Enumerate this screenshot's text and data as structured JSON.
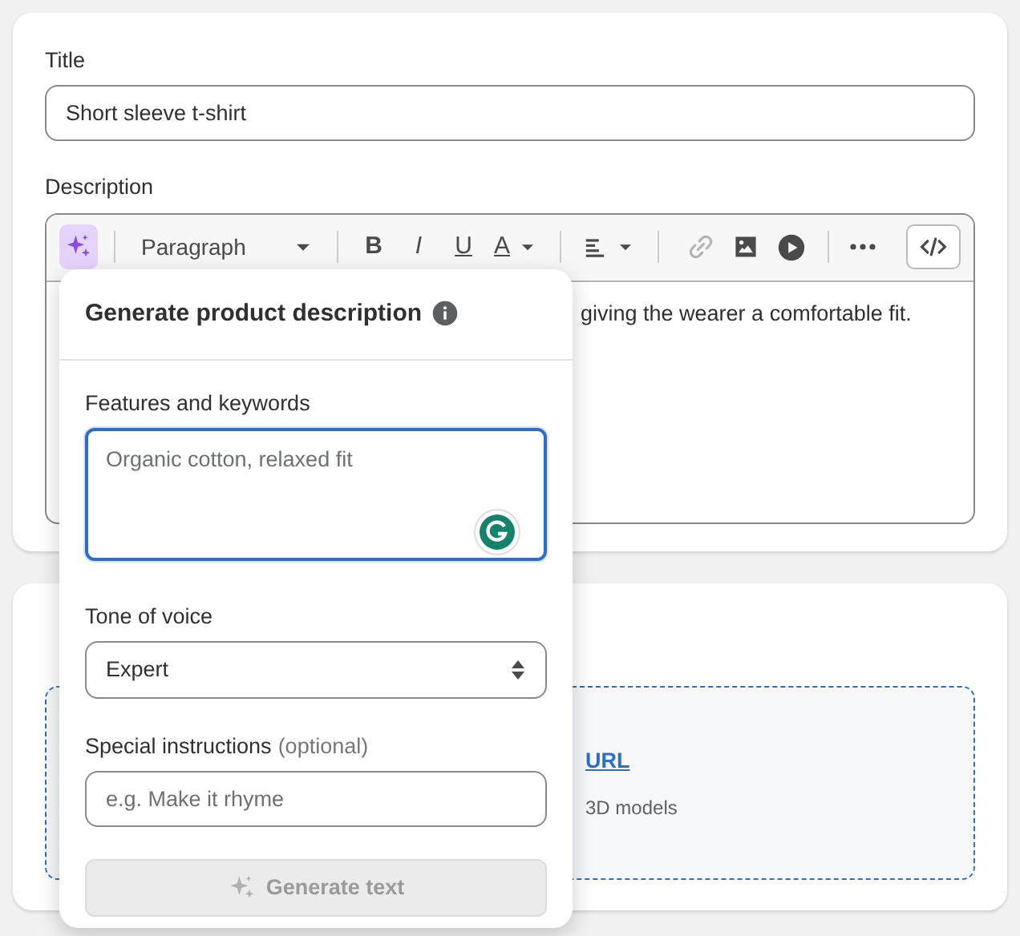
{
  "title_field": {
    "label": "Title",
    "value": "Short sleeve t-shirt"
  },
  "description": {
    "label": "Description",
    "toolbar": [
      {
        "kind": "ai",
        "disabled": false
      },
      {
        "kind": "separator"
      },
      {
        "kind": "dropdown",
        "label": "Paragraph",
        "disabled": false
      },
      {
        "kind": "separator"
      },
      {
        "kind": "bold",
        "label": "B",
        "disabled": false
      },
      {
        "kind": "italic",
        "label": "I",
        "disabled": false
      },
      {
        "kind": "underline",
        "label": "U",
        "disabled": false
      },
      {
        "kind": "text-color",
        "label": "A",
        "disabled": false
      },
      {
        "kind": "separator"
      },
      {
        "kind": "align",
        "disabled": false
      },
      {
        "kind": "separator"
      },
      {
        "kind": "link",
        "disabled": true
      },
      {
        "kind": "image",
        "disabled": false
      },
      {
        "kind": "video",
        "disabled": false
      },
      {
        "kind": "separator"
      },
      {
        "kind": "more",
        "disabled": false
      },
      {
        "kind": "code",
        "disabled": false
      }
    ],
    "content": "giving the wearer a comfortable fit."
  },
  "media_card": {
    "link": "URL",
    "hint": "3D models"
  },
  "popover": {
    "title": "Generate product description",
    "features": {
      "label": "Features and keywords",
      "placeholder": "Organic cotton, relaxed fit",
      "focused": true
    },
    "tone": {
      "label": "Tone of voice",
      "value": "Expert"
    },
    "instructions": {
      "label": "Special instructions",
      "note": "(optional)",
      "placeholder": "e.g. Make it rhyme"
    },
    "generate_button": {
      "label": "Generate text",
      "disabled": true
    }
  }
}
